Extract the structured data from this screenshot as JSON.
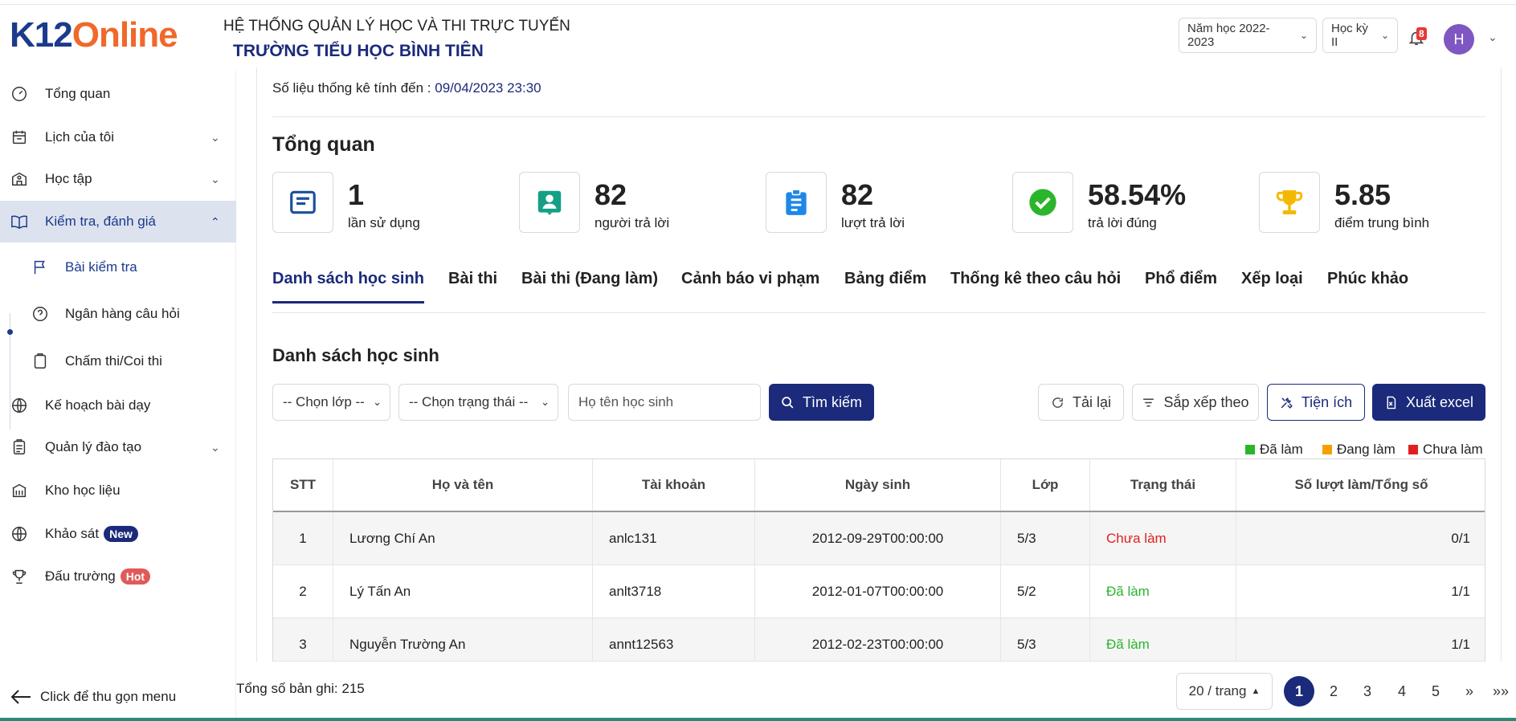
{
  "header": {
    "logo_k12": "K12",
    "logo_online": "Online",
    "system_title": "HỆ THỐNG QUẢN LÝ HỌC VÀ THI TRỰC TUYẾN",
    "school_name": "TRƯỜNG TIỂU HỌC BÌNH TIÊN",
    "school_year": "Năm học 2022-2023",
    "semester": "Học kỳ II",
    "notification_count": "8",
    "avatar_letter": "H"
  },
  "sidebar": {
    "items": [
      {
        "label": "Tổng quan",
        "icon": "dashboard-icon"
      },
      {
        "label": "Lịch của tôi",
        "icon": "calendar-icon"
      },
      {
        "label": "Học tập",
        "icon": "school-icon"
      },
      {
        "label": "Kiểm tra, đánh giá",
        "icon": "book-icon"
      },
      {
        "label": "Kế hoạch bài dạy",
        "icon": "globe-icon"
      },
      {
        "label": "Quản lý đào tạo",
        "icon": "clipboard-icon"
      },
      {
        "label": "Kho học liệu",
        "icon": "library-icon"
      },
      {
        "label": "Khảo sát",
        "icon": "globe-icon"
      },
      {
        "label": "Đấu trường",
        "icon": "trophy-icon"
      }
    ],
    "sub_items": [
      {
        "label": "Bài kiểm tra",
        "icon": "flag-icon"
      },
      {
        "label": "Ngân hàng câu hỏi",
        "icon": "question-icon"
      },
      {
        "label": "Chấm thi/Coi thi",
        "icon": "clipboard-icon"
      }
    ],
    "badge_new": "New",
    "badge_hot": "Hot",
    "collapse_label": "Click để thu gọn menu"
  },
  "main": {
    "stat_label": "Số liệu thống kê tính đến : ",
    "stat_time": "09/04/2023 23:30",
    "overview_title": "Tổng quan",
    "cards": [
      {
        "value": "1",
        "caption": "lần sử dụng",
        "icon": "document-icon",
        "color": "#1b4f9c"
      },
      {
        "value": "82",
        "caption": "người trả lời",
        "icon": "person-icon",
        "color": "#14a085"
      },
      {
        "value": "82",
        "caption": "lượt trả lời",
        "icon": "clipboard-list-icon",
        "color": "#1e88e5"
      },
      {
        "value": "58.54%",
        "caption": "trả lời đúng",
        "icon": "check-circle-icon",
        "color": "#2bb52b"
      },
      {
        "value": "5.85",
        "caption": "điểm trung bình",
        "icon": "trophy-icon",
        "color": "#f5b800"
      }
    ],
    "tabs": [
      "Danh sách học sinh",
      "Bài thi",
      "Bài thi (Đang làm)",
      "Cảnh báo vi phạm",
      "Bảng điểm",
      "Thống kê theo câu hỏi",
      "Phổ điểm",
      "Xếp loại",
      "Phúc khảo"
    ],
    "list_title": "Danh sách học sinh",
    "filters": {
      "class_select": "-- Chọn lớp --",
      "status_select": "-- Chọn trạng thái --",
      "name_placeholder": "Họ tên học sinh",
      "search_button": "Tìm kiếm",
      "reload_button": "Tải lại",
      "sort_button": "Sắp xếp theo",
      "utility_button": "Tiện ích",
      "export_button": "Xuất excel"
    },
    "legend": [
      {
        "label": "Đã làm",
        "color": "#2bb52b"
      },
      {
        "label": "Đang làm",
        "color": "#f5a000"
      },
      {
        "label": "Chưa làm",
        "color": "#e02020"
      }
    ],
    "table": {
      "headers": [
        "STT",
        "Họ và tên",
        "Tài khoản",
        "Ngày sinh",
        "Lớp",
        "Trạng thái",
        "Số lượt làm/Tổng số"
      ],
      "rows": [
        {
          "stt": "1",
          "name": "Lương Chí An",
          "account": "anlc131",
          "dob": "2012-09-29T00:00:00",
          "class": "5/3",
          "status": "Chưa làm",
          "status_color": "red",
          "count": "0/1"
        },
        {
          "stt": "2",
          "name": "Lý Tấn An",
          "account": "anlt3718",
          "dob": "2012-01-07T00:00:00",
          "class": "5/2",
          "status": "Đã làm",
          "status_color": "green",
          "count": "1/1"
        },
        {
          "stt": "3",
          "name": "Nguyễn Trường An",
          "account": "annt12563",
          "dob": "2012-02-23T00:00:00",
          "class": "5/3",
          "status": "Đã làm",
          "status_color": "green",
          "count": "1/1"
        }
      ]
    },
    "pagination": {
      "total_label": "Tổng số bản ghi: 215",
      "page_size": "20 / trang",
      "pages": [
        "1",
        "2",
        "3",
        "4",
        "5",
        "»",
        "»»"
      ]
    }
  }
}
